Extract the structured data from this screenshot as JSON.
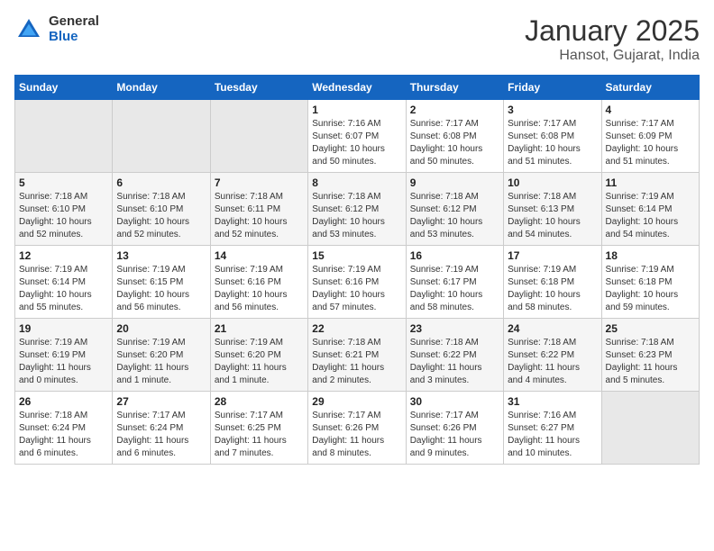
{
  "logo": {
    "general": "General",
    "blue": "Blue"
  },
  "title": "January 2025",
  "subtitle": "Hansot, Gujarat, India",
  "weekdays": [
    "Sunday",
    "Monday",
    "Tuesday",
    "Wednesday",
    "Thursday",
    "Friday",
    "Saturday"
  ],
  "weeks": [
    [
      {
        "day": "",
        "info": ""
      },
      {
        "day": "",
        "info": ""
      },
      {
        "day": "",
        "info": ""
      },
      {
        "day": "1",
        "info": "Sunrise: 7:16 AM\nSunset: 6:07 PM\nDaylight: 10 hours\nand 50 minutes."
      },
      {
        "day": "2",
        "info": "Sunrise: 7:17 AM\nSunset: 6:08 PM\nDaylight: 10 hours\nand 50 minutes."
      },
      {
        "day": "3",
        "info": "Sunrise: 7:17 AM\nSunset: 6:08 PM\nDaylight: 10 hours\nand 51 minutes."
      },
      {
        "day": "4",
        "info": "Sunrise: 7:17 AM\nSunset: 6:09 PM\nDaylight: 10 hours\nand 51 minutes."
      }
    ],
    [
      {
        "day": "5",
        "info": "Sunrise: 7:18 AM\nSunset: 6:10 PM\nDaylight: 10 hours\nand 52 minutes."
      },
      {
        "day": "6",
        "info": "Sunrise: 7:18 AM\nSunset: 6:10 PM\nDaylight: 10 hours\nand 52 minutes."
      },
      {
        "day": "7",
        "info": "Sunrise: 7:18 AM\nSunset: 6:11 PM\nDaylight: 10 hours\nand 52 minutes."
      },
      {
        "day": "8",
        "info": "Sunrise: 7:18 AM\nSunset: 6:12 PM\nDaylight: 10 hours\nand 53 minutes."
      },
      {
        "day": "9",
        "info": "Sunrise: 7:18 AM\nSunset: 6:12 PM\nDaylight: 10 hours\nand 53 minutes."
      },
      {
        "day": "10",
        "info": "Sunrise: 7:18 AM\nSunset: 6:13 PM\nDaylight: 10 hours\nand 54 minutes."
      },
      {
        "day": "11",
        "info": "Sunrise: 7:19 AM\nSunset: 6:14 PM\nDaylight: 10 hours\nand 54 minutes."
      }
    ],
    [
      {
        "day": "12",
        "info": "Sunrise: 7:19 AM\nSunset: 6:14 PM\nDaylight: 10 hours\nand 55 minutes."
      },
      {
        "day": "13",
        "info": "Sunrise: 7:19 AM\nSunset: 6:15 PM\nDaylight: 10 hours\nand 56 minutes."
      },
      {
        "day": "14",
        "info": "Sunrise: 7:19 AM\nSunset: 6:16 PM\nDaylight: 10 hours\nand 56 minutes."
      },
      {
        "day": "15",
        "info": "Sunrise: 7:19 AM\nSunset: 6:16 PM\nDaylight: 10 hours\nand 57 minutes."
      },
      {
        "day": "16",
        "info": "Sunrise: 7:19 AM\nSunset: 6:17 PM\nDaylight: 10 hours\nand 58 minutes."
      },
      {
        "day": "17",
        "info": "Sunrise: 7:19 AM\nSunset: 6:18 PM\nDaylight: 10 hours\nand 58 minutes."
      },
      {
        "day": "18",
        "info": "Sunrise: 7:19 AM\nSunset: 6:18 PM\nDaylight: 10 hours\nand 59 minutes."
      }
    ],
    [
      {
        "day": "19",
        "info": "Sunrise: 7:19 AM\nSunset: 6:19 PM\nDaylight: 11 hours\nand 0 minutes."
      },
      {
        "day": "20",
        "info": "Sunrise: 7:19 AM\nSunset: 6:20 PM\nDaylight: 11 hours\nand 1 minute."
      },
      {
        "day": "21",
        "info": "Sunrise: 7:19 AM\nSunset: 6:20 PM\nDaylight: 11 hours\nand 1 minute."
      },
      {
        "day": "22",
        "info": "Sunrise: 7:18 AM\nSunset: 6:21 PM\nDaylight: 11 hours\nand 2 minutes."
      },
      {
        "day": "23",
        "info": "Sunrise: 7:18 AM\nSunset: 6:22 PM\nDaylight: 11 hours\nand 3 minutes."
      },
      {
        "day": "24",
        "info": "Sunrise: 7:18 AM\nSunset: 6:22 PM\nDaylight: 11 hours\nand 4 minutes."
      },
      {
        "day": "25",
        "info": "Sunrise: 7:18 AM\nSunset: 6:23 PM\nDaylight: 11 hours\nand 5 minutes."
      }
    ],
    [
      {
        "day": "26",
        "info": "Sunrise: 7:18 AM\nSunset: 6:24 PM\nDaylight: 11 hours\nand 6 minutes."
      },
      {
        "day": "27",
        "info": "Sunrise: 7:17 AM\nSunset: 6:24 PM\nDaylight: 11 hours\nand 6 minutes."
      },
      {
        "day": "28",
        "info": "Sunrise: 7:17 AM\nSunset: 6:25 PM\nDaylight: 11 hours\nand 7 minutes."
      },
      {
        "day": "29",
        "info": "Sunrise: 7:17 AM\nSunset: 6:26 PM\nDaylight: 11 hours\nand 8 minutes."
      },
      {
        "day": "30",
        "info": "Sunrise: 7:17 AM\nSunset: 6:26 PM\nDaylight: 11 hours\nand 9 minutes."
      },
      {
        "day": "31",
        "info": "Sunrise: 7:16 AM\nSunset: 6:27 PM\nDaylight: 11 hours\nand 10 minutes."
      },
      {
        "day": "",
        "info": ""
      }
    ]
  ]
}
